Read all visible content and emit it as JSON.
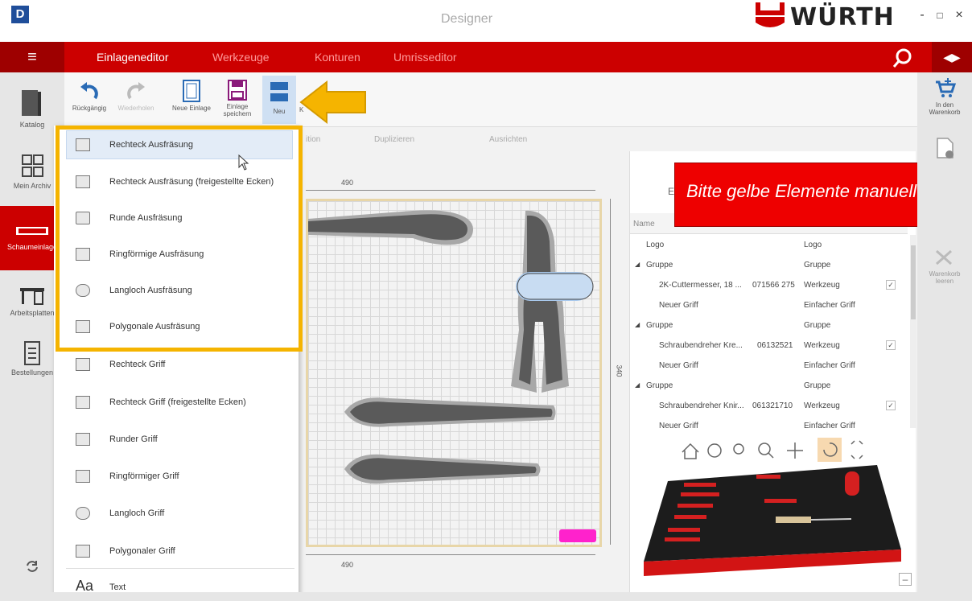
{
  "window": {
    "title": "Designer",
    "app_icon": "D",
    "brand": "WÜRTH",
    "minimize": "-",
    "maximize": "□",
    "close": "×"
  },
  "nav": {
    "tabs": [
      "Einlageneditor",
      "Werkzeuge",
      "Konturen",
      "Umrisseditor"
    ],
    "active": "Einlageneditor",
    "accent": "#cc0000"
  },
  "leftbar": {
    "items": [
      {
        "label": "Katalog",
        "icon": "book-icon"
      },
      {
        "label": "Mein Archiv",
        "icon": "grid-icon"
      },
      {
        "label": "Schaumeinlage",
        "icon": "foam-insert-icon"
      },
      {
        "label": "Arbeitsplatten",
        "icon": "workbench-icon"
      },
      {
        "label": "Bestellungen",
        "icon": "list-icon"
      }
    ]
  },
  "ribbon": {
    "undo": "Rückgängig",
    "redo": "Wiederholen",
    "new_insert": "Neue Einlage",
    "save_line1": "Einlage",
    "save_line2": "speichern",
    "neu": "Neu",
    "partial": "K"
  },
  "subribbon": {
    "position": "ition",
    "duplicate": "Duplizieren",
    "align": "Ausrichten"
  },
  "canvas": {
    "dim_top": "490",
    "dim_bottom": "490",
    "dim_side": "340"
  },
  "rightbar": {
    "cart_line1": "In den",
    "cart_line2": "Warenkorb",
    "clear_line1": "Warenkorb",
    "clear_line2": "leeren"
  },
  "tree": {
    "header_name": "Name",
    "panel_partial": "E",
    "rows": [
      {
        "name": "Logo",
        "article": "",
        "type": "Logo",
        "checked": false,
        "level": 0,
        "expander": false
      },
      {
        "name": "Gruppe",
        "article": "",
        "type": "Gruppe",
        "checked": false,
        "level": 0,
        "expander": true
      },
      {
        "name": "2K-Cuttermesser, 18 ...",
        "article": "071566 275",
        "type": "Werkzeug",
        "checked": true,
        "level": 1,
        "expander": false
      },
      {
        "name": "Neuer Griff",
        "article": "",
        "type": "Einfacher Griff",
        "checked": false,
        "level": 1,
        "expander": false
      },
      {
        "name": "Gruppe",
        "article": "",
        "type": "Gruppe",
        "checked": false,
        "level": 0,
        "expander": true
      },
      {
        "name": "Schraubendreher Kre...",
        "article": "06132521",
        "type": "Werkzeug",
        "checked": true,
        "level": 1,
        "expander": false
      },
      {
        "name": "Neuer Griff",
        "article": "",
        "type": "Einfacher Griff",
        "checked": false,
        "level": 1,
        "expander": false
      },
      {
        "name": "Gruppe",
        "article": "",
        "type": "Gruppe",
        "checked": false,
        "level": 0,
        "expander": true
      },
      {
        "name": "Schraubendreher Knir...",
        "article": "061321710",
        "type": "Werkzeug",
        "checked": true,
        "level": 1,
        "expander": false
      },
      {
        "name": "Neuer Griff",
        "article": "",
        "type": "Einfacher Griff",
        "checked": false,
        "level": 1,
        "expander": false
      }
    ]
  },
  "banner": {
    "text": "Bitte gelbe Elemente manuell"
  },
  "dropdown": {
    "items": [
      {
        "label": "Rechteck Ausfräsung",
        "icon": "rectangle-cutout-icon"
      },
      {
        "label": "Rechteck Ausfräsung (freigestellte Ecken)",
        "icon": "rectangle-relief-cutout-icon"
      },
      {
        "label": "Runde Ausfräsung",
        "icon": "circle-cutout-icon"
      },
      {
        "label": "Ringförmige Ausfräsung",
        "icon": "ring-cutout-icon"
      },
      {
        "label": "Langloch Ausfräsung",
        "icon": "slot-cutout-icon"
      },
      {
        "label": "Polygonale Ausfräsung",
        "icon": "polygon-cutout-icon"
      },
      {
        "label": "Rechteck Griff",
        "icon": "rectangle-grip-icon"
      },
      {
        "label": "Rechteck Griff (freigestellte Ecken)",
        "icon": "rectangle-relief-grip-icon"
      },
      {
        "label": "Runder Griff",
        "icon": "circle-grip-icon"
      },
      {
        "label": "Ringförmiger Griff",
        "icon": "ring-grip-icon"
      },
      {
        "label": "Langloch Griff",
        "icon": "slot-grip-icon"
      },
      {
        "label": "Polygonaler Griff",
        "icon": "polygon-grip-icon"
      },
      {
        "label": "Text",
        "icon": "text-icon"
      }
    ],
    "highlighted": "Rechteck Ausfräsung",
    "text_icon_glyph": "Aa"
  },
  "colors": {
    "highlight": "#f5b400",
    "selection": "#cfe0f3",
    "tool": "#5a5a5a",
    "tool_halo": "#a7a7a7",
    "logo_marker": "#ff22cc"
  }
}
